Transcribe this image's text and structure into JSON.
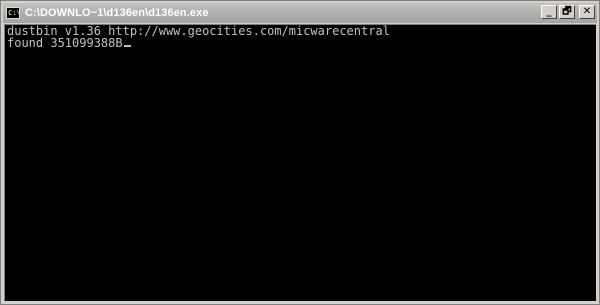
{
  "window": {
    "title": "C:\\DOWNLO~1\\d136en\\d136en.exe",
    "icon": "console-icon",
    "icon_glyph": "C:\\",
    "controls": {
      "minimize_glyph": "_",
      "restore_glyph": "🗗",
      "close_glyph": "✕"
    }
  },
  "console": {
    "lines": [
      "dustbin v1.36 http://www.geocities.com/micwarecentral",
      "found 351099388B"
    ],
    "text_color": "#c0c0c0",
    "background_color": "#000000"
  }
}
